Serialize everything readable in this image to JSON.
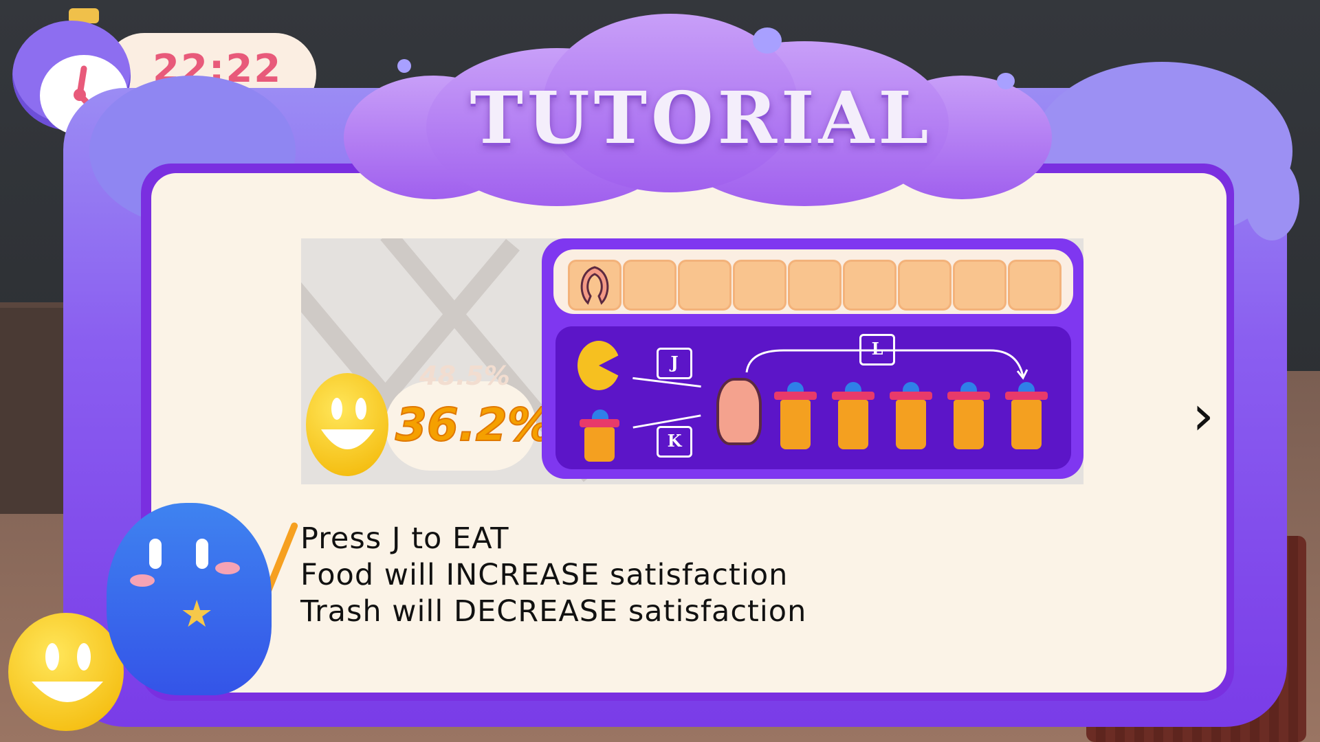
{
  "timer": {
    "value": "22:22"
  },
  "title": "TUTORIAL",
  "illustration": {
    "satisfaction": "36.2%",
    "satisfaction_ghost": "48.5%",
    "inventory_slots": 9,
    "inventory_first_count": "1",
    "keys": {
      "eat": "J",
      "trash": "K",
      "cycle": "L"
    }
  },
  "instructions": [
    "Press J to EAT",
    "Food will INCREASE satisfaction",
    "Trash will DECREASE satisfaction"
  ],
  "next_label": "›",
  "colors": {
    "frame": "#8a5ef0",
    "panel": "#fbf3e7",
    "accent": "#7f37f0",
    "satisfaction": "#f5a000"
  }
}
